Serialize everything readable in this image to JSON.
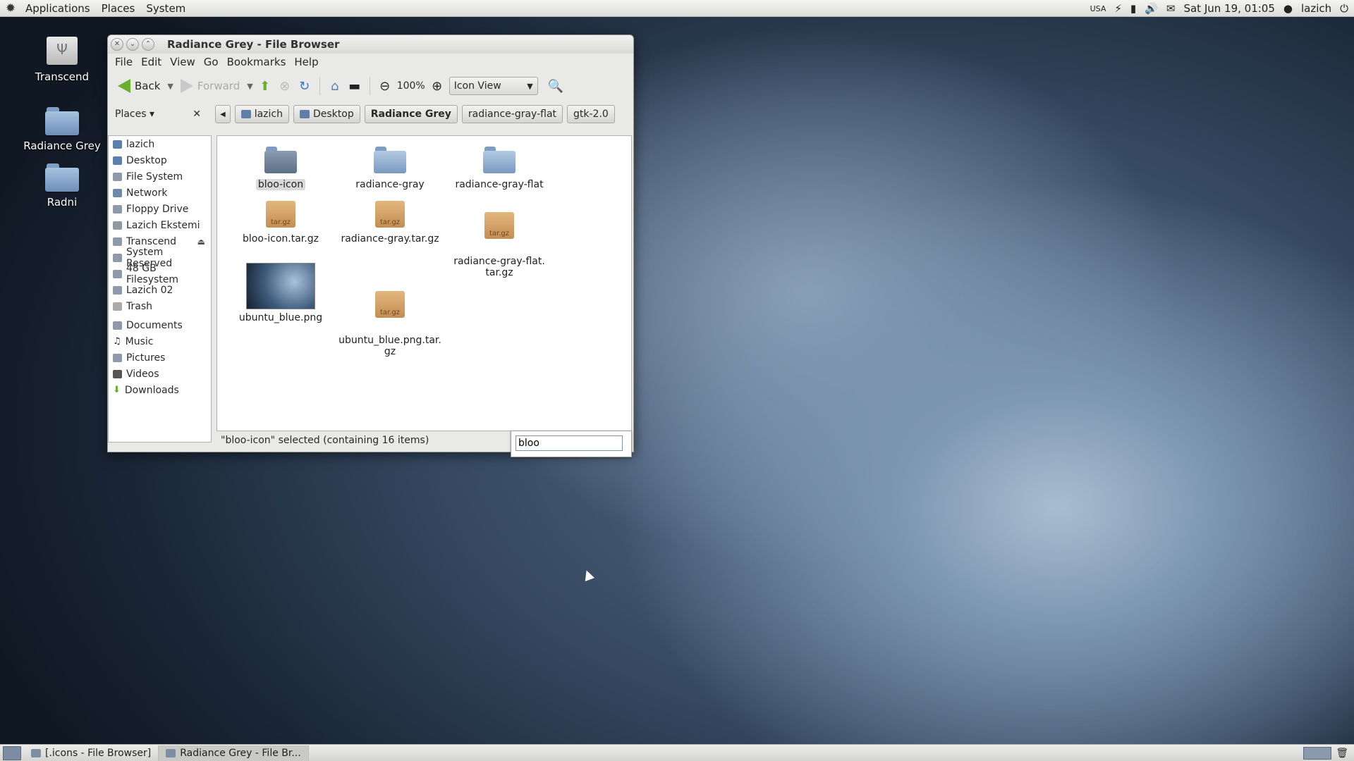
{
  "top_panel": {
    "menus": [
      "Applications",
      "Places",
      "System"
    ],
    "tray": {
      "keyboard": "USA",
      "datetime": "Sat Jun 19, 01:05",
      "user": "lazich"
    }
  },
  "desktop": {
    "icons": [
      {
        "label": "Transcend",
        "kind": "drive"
      },
      {
        "label": "Radiance Grey",
        "kind": "folder"
      },
      {
        "label": "Radni",
        "kind": "folder"
      }
    ]
  },
  "window": {
    "title": "Radiance Grey - File Browser",
    "menus": [
      "File",
      "Edit",
      "View",
      "Go",
      "Bookmarks",
      "Help"
    ],
    "toolbar": {
      "back": "Back",
      "forward": "Forward",
      "zoom": "100%",
      "view_mode": "Icon View"
    },
    "places_label": "Places",
    "breadcrumbs": [
      {
        "label": "lazich",
        "icon": "home-icon"
      },
      {
        "label": "Desktop",
        "icon": "desktop-icon"
      },
      {
        "label": "Radiance Grey",
        "active": true
      },
      {
        "label": "radiance-gray-flat"
      },
      {
        "label": "gtk-2.0"
      }
    ],
    "sidebar": {
      "devices": [
        "lazich",
        "Desktop",
        "File System",
        "Network",
        "Floppy Drive",
        "Lazich Ekstemi",
        "Transcend",
        "System Reserved",
        "48 GB Filesystem",
        "Lazich 02",
        "Trash"
      ],
      "bookmarks": [
        "Documents",
        "Music",
        "Pictures",
        "Videos",
        "Downloads"
      ]
    },
    "files": [
      {
        "name": "bloo-icon",
        "kind": "folder-dark",
        "selected": true
      },
      {
        "name": "radiance-gray",
        "kind": "folder"
      },
      {
        "name": "radiance-gray-flat",
        "kind": "folder"
      },
      {
        "name": "bloo-icon.tar.gz",
        "kind": "archive",
        "badge": "tar.gz"
      },
      {
        "name": "radiance-gray.tar.gz",
        "kind": "archive",
        "badge": "tar.gz"
      },
      {
        "name": "radiance-gray-flat.\ntar.gz",
        "kind": "archive",
        "badge": "tar.gz"
      },
      {
        "name": "ubuntu_blue.png",
        "kind": "image"
      },
      {
        "name": "ubuntu_blue.png.tar.\ngz",
        "kind": "archive",
        "badge": "tar.gz"
      }
    ],
    "status": "\"bloo-icon\" selected (containing 16 items)",
    "typeahead_value": "bloo"
  },
  "taskbar": {
    "tasks": [
      {
        "label": "[.icons - File Browser]",
        "active": false
      },
      {
        "label": "Radiance Grey - File Br...",
        "active": true
      }
    ]
  }
}
